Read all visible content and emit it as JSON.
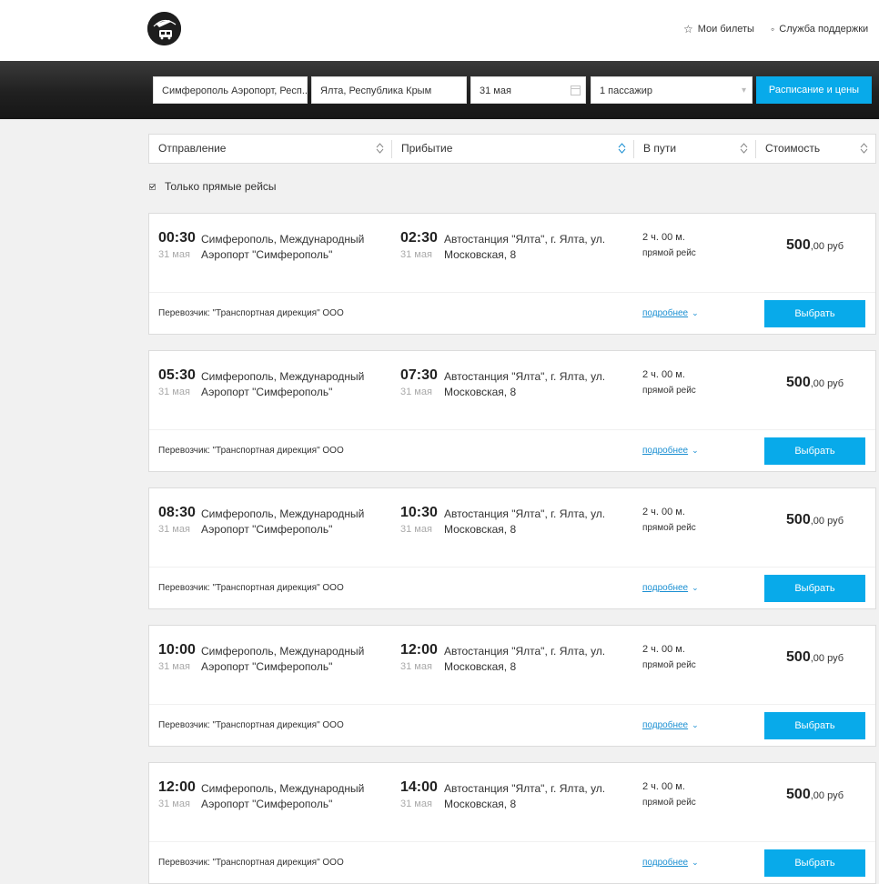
{
  "header": {
    "my_tickets": "Мои билеты",
    "support": "Служба поддержки",
    "star_icon": "star-outline",
    "support_icon": "headset"
  },
  "search": {
    "from": "Симферополь Аэропорт, Респ..",
    "to": "Ялта, Республика Крым",
    "date": "31 мая",
    "passengers": "1 пассажир",
    "button": "Расписание и цены"
  },
  "sort": {
    "departure": "Отправление",
    "arrival": "Прибытие",
    "duration": "В пути",
    "price": "Стоимость"
  },
  "filters": {
    "direct_only": "Только прямые рейсы",
    "direct_only_checked": true
  },
  "trips": [
    {
      "dep_time": "00:30",
      "dep_date": "31 мая",
      "dep_place": "Симферополь, Международный Аэропорт \"Симферополь\"",
      "arr_time": "02:30",
      "arr_date": "31 мая",
      "arr_place": "Автостанция \"Ялта\", г. Ялта, ул. Московская, 8",
      "duration": "2 ч. 00 м.",
      "type": "прямой рейс",
      "price_int": "500",
      "price_dec": ",00",
      "currency": "руб",
      "carrier": "Перевозчик: \"Транспортная дирекция\" ООО",
      "more": "подробнее",
      "select": "Выбрать"
    },
    {
      "dep_time": "05:30",
      "dep_date": "31 мая",
      "dep_place": "Симферополь, Международный Аэропорт \"Симферополь\"",
      "arr_time": "07:30",
      "arr_date": "31 мая",
      "arr_place": "Автостанция \"Ялта\", г. Ялта, ул. Московская, 8",
      "duration": "2 ч. 00 м.",
      "type": "прямой рейс",
      "price_int": "500",
      "price_dec": ",00",
      "currency": "руб",
      "carrier": "Перевозчик: \"Транспортная дирекция\" ООО",
      "more": "подробнее",
      "select": "Выбрать"
    },
    {
      "dep_time": "08:30",
      "dep_date": "31 мая",
      "dep_place": "Симферополь, Международный Аэропорт \"Симферополь\"",
      "arr_time": "10:30",
      "arr_date": "31 мая",
      "arr_place": "Автостанция \"Ялта\", г. Ялта, ул. Московская, 8",
      "duration": "2 ч. 00 м.",
      "type": "прямой рейс",
      "price_int": "500",
      "price_dec": ",00",
      "currency": "руб",
      "carrier": "Перевозчик: \"Транспортная дирекция\" ООО",
      "more": "подробнее",
      "select": "Выбрать"
    },
    {
      "dep_time": "10:00",
      "dep_date": "31 мая",
      "dep_place": "Симферополь, Международный Аэропорт \"Симферополь\"",
      "arr_time": "12:00",
      "arr_date": "31 мая",
      "arr_place": "Автостанция \"Ялта\", г. Ялта, ул. Московская, 8",
      "duration": "2 ч. 00 м.",
      "type": "прямой рейс",
      "price_int": "500",
      "price_dec": ",00",
      "currency": "руб",
      "carrier": "Перевозчик: \"Транспортная дирекция\" ООО",
      "more": "подробнее",
      "select": "Выбрать"
    },
    {
      "dep_time": "12:00",
      "dep_date": "31 мая",
      "dep_place": "Симферополь, Международный Аэропорт \"Симферополь\"",
      "arr_time": "14:00",
      "arr_date": "31 мая",
      "arr_place": "Автостанция \"Ялта\", г. Ялта, ул. Московская, 8",
      "duration": "2 ч. 00 м.",
      "type": "прямой рейс",
      "price_int": "500",
      "price_dec": ",00",
      "currency": "руб",
      "carrier": "Перевозчик: \"Транспортная дирекция\" ООО",
      "more": "подробнее",
      "select": "Выбрать"
    }
  ],
  "colors": {
    "accent": "#08aaea",
    "link": "#1a8fd2",
    "header_dark": "#1e1e1e",
    "page_bg": "#f1f1f1"
  }
}
